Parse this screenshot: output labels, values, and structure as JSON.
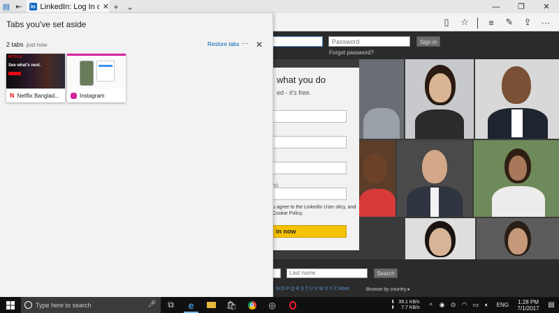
{
  "browser": {
    "active_tab_title": "LinkedIn: Log In or Sign",
    "tab_close": "✕",
    "new_tab": "+",
    "tab_list": "⌄",
    "window_controls": [
      "—",
      "❐",
      "✕"
    ]
  },
  "page": {
    "password_placeholder": "Password",
    "signin_label": "Sign in",
    "forgot_password": "Forgot password?",
    "join_heading": "what you do",
    "join_sub": "ed - it's free.",
    "join_hint": "rs)",
    "join_terms": "u agree to the LinkedIn User olicy, and Cookie Policy.",
    "join_button": "in now",
    "lastname_placeholder": "Last name",
    "search_label": "Search",
    "alphabet": "N O P Q R S T U V W X Y Z More",
    "browse_country": "Browse by country ▸"
  },
  "aside": {
    "title": "Tabs you've set aside",
    "count": "2 tabs",
    "time": "just now",
    "restore": "Restore tabs",
    "more": "···",
    "close": "✕",
    "tabs": [
      {
        "label": "Netflix Banglad..."
      },
      {
        "label": "Instagram"
      }
    ],
    "netflix_preview_text": "See what's next."
  },
  "taskbar": {
    "search_placeholder": "Type here to search",
    "net_down": "39.1 KB/s",
    "net_up": "7.7 KB/s",
    "language": "ENG",
    "time": "1:28 PM",
    "date": "7/1/2017"
  },
  "colors": {
    "edge_blue": "#0063b1",
    "linkedin_blue": "#0a66c2",
    "join_yellow": "#f6c300",
    "netflix_red": "#e50914"
  }
}
